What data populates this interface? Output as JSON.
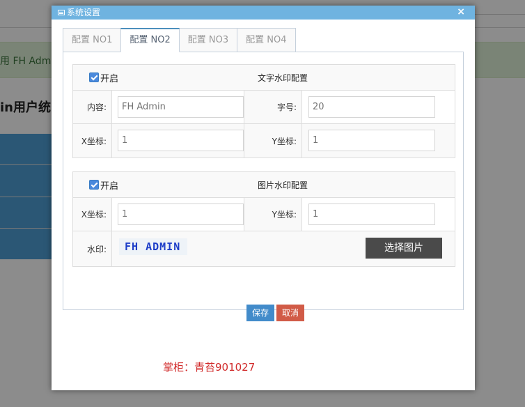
{
  "background": {
    "alert_text": "用 FH Admi",
    "heading": "in用户统"
  },
  "dialog": {
    "title": "系统设置",
    "close": "×"
  },
  "tabs": [
    {
      "label": "配置 NO1",
      "active": false
    },
    {
      "label": "配置 NO2",
      "active": true
    },
    {
      "label": "配置 NO3",
      "active": false
    },
    {
      "label": "配置 NO4",
      "active": false
    }
  ],
  "text_watermark": {
    "enable_label": "开启",
    "enabled": true,
    "title": "文字水印配置",
    "content_label": "内容:",
    "content_placeholder": "FH Admin",
    "font_size_label": "字号:",
    "font_size_placeholder": "20",
    "x_label": "X坐标:",
    "x_placeholder": "1",
    "y_label": "Y坐标:",
    "y_placeholder": "1"
  },
  "image_watermark": {
    "enable_label": "开启",
    "enabled": true,
    "title": "图片水印配置",
    "x_label": "X坐标:",
    "x_placeholder": "1",
    "y_label": "Y坐标:",
    "y_placeholder": "1",
    "watermark_label": "水印:",
    "watermark_preview": "FH ADMIN",
    "choose_image": "选择图片"
  },
  "actions": {
    "save": "保存",
    "cancel": "取消"
  },
  "footer": {
    "shopkeeper": "掌柜：青苔901027"
  },
  "colors": {
    "header": "#6fb3e0",
    "save": "#428bca",
    "cancel": "#d15b47",
    "choose_button": "#4a4a4a",
    "shopkeeper_text": "#d12b2b"
  }
}
